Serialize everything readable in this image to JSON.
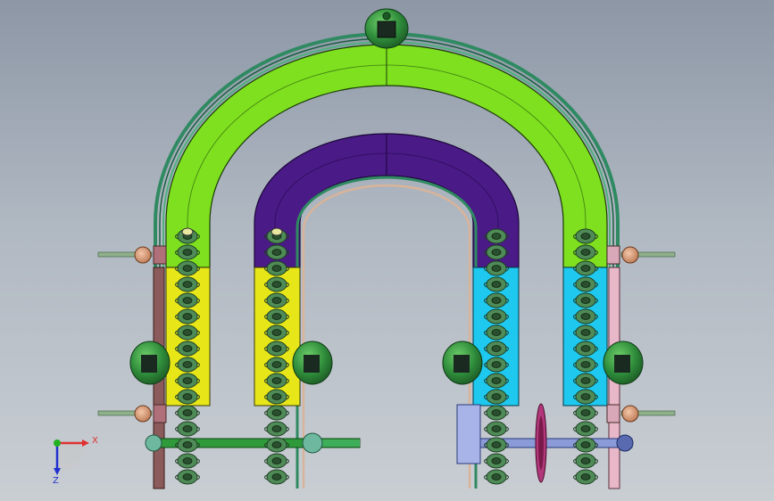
{
  "viewport": {
    "background_top": "#8d97a6",
    "background_bottom": "#c9ced3"
  },
  "colors": {
    "outer_arch": "#7ee01e",
    "inner_arch": "#4a1a86",
    "yellow_guides": "#e7e619",
    "cyan_guides": "#1ec8ee",
    "chain": "#3f7a46",
    "rail": "#2f8a62",
    "bearing": "#2e8b3a",
    "bracket": "#d09a7a",
    "shaft_blue": "#8b9ad8",
    "sprocket": "#b0387a",
    "triad_x": "#e03030",
    "triad_y": "#20b020",
    "triad_z": "#2030d0"
  },
  "triad": {
    "x_label": "X",
    "z_label": "Z"
  }
}
